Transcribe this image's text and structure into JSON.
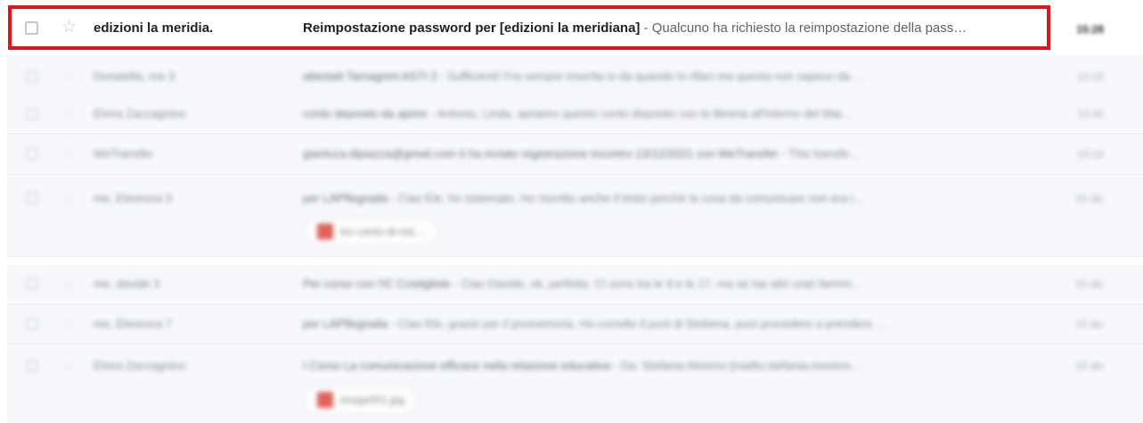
{
  "emails": [
    {
      "sender": "edizioni la meridia.",
      "subject": "Reimpostazione password per [edizioni la meridiana]",
      "snippet": " - Qualcuno ha richiesto la reimpostazione della pass…",
      "time": "15:28",
      "unread": true,
      "highlighted": true
    },
    {
      "sender": "Donatella, me 3",
      "subject": "attestati Tamagnini ASTI 2",
      "snippet": " - Sufficienti! Fra sempre inserita io da quando lo rifaci ma questa non sapevo da …",
      "time": "13:16",
      "unread": false
    },
    {
      "sender": "Elvira Zaccagnino",
      "subject": "conto deposito da aprire",
      "snippet": " - Antonio, Linda, apriamo questo conto deposito con la libreria all'interno del Mat…",
      "time": "12:40",
      "unread": false
    },
    {
      "sender": "WeTransfer",
      "subject": "gianluca.dipiazza@gmail.com ti ha inviato registrazione incontro 13/12/2021 con WeTransfer",
      "snippet": " - This transfe…",
      "time": "10:10",
      "unread": false
    },
    {
      "sender": "me, Eleonora 3",
      "subject": "per LAPflegnaila",
      "snippet": " - Ciao Ele, ho sistemato. Ho riscritto anche il testo perché la cosa da comunicare non era i…",
      "time": "15 dic",
      "attachment": "loc-canto-di-nat…",
      "unread": false
    },
    {
      "sender": "me, davide 3",
      "subject": "Per corso con l'IC Costigliole",
      "snippet": " - Ciao Davide, ok, perfetto. Ci sono tra le 9 e le 17, ma se hai altri orari fammi…",
      "time": "15 dic",
      "unread": false
    },
    {
      "sender": "me, Eleonora 7",
      "subject": "per LAPflegnaila",
      "snippet": " - Ciao Ele, grazie per il promemoria. Ho corretto il post di Stobena, puoi procedere a prendere …",
      "time": "15 dic",
      "unread": false
    },
    {
      "sender": "Elvira Zaccagnino",
      "subject": "I Corso La comunicazione efficace nella relazione educativa",
      "snippet": " - Da: Stefania Moreno [mailto:stefania.moreno…",
      "time": "15 dic",
      "attachment": "image001.jpg",
      "unread": false
    }
  ]
}
